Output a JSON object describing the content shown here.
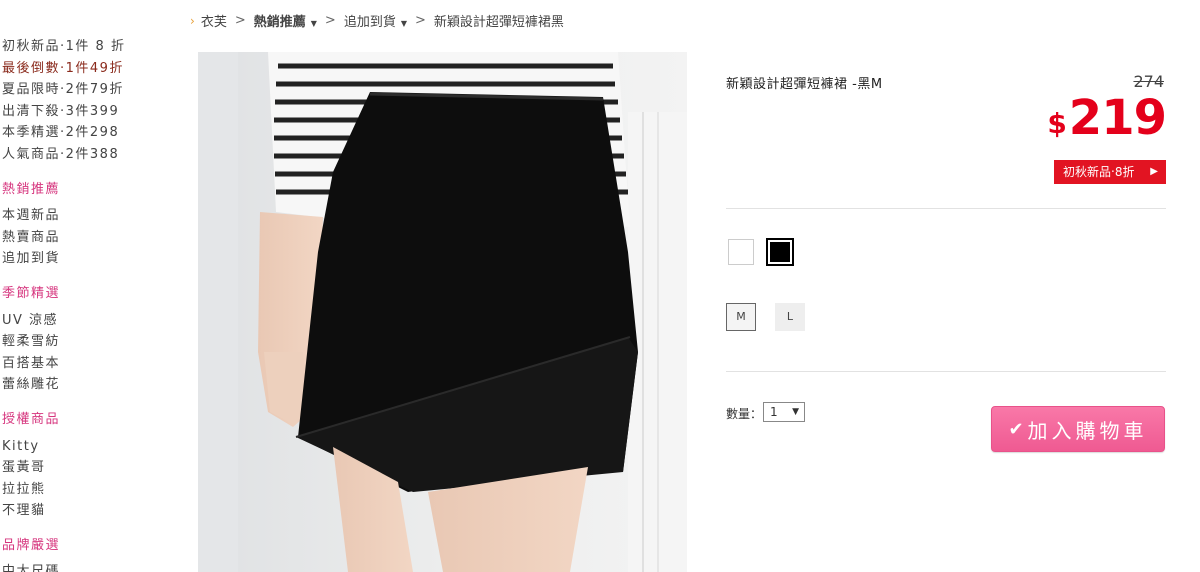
{
  "breadcrumb": {
    "items": [
      "衣芙",
      "熱銷推薦",
      "追加到貨",
      "新穎設計超彈短褲裙黑"
    ]
  },
  "sidebar": {
    "promo_items": [
      "初秋新品‧1件 8 折",
      "最後倒數‧1件49折",
      "夏品限時‧2件79折",
      "出清下殺‧3件399",
      "本季精選‧2件298",
      "人氣商品‧2件388"
    ],
    "sections": [
      {
        "title": "熱銷推薦",
        "items": [
          "本週新品",
          "熱賣商品",
          "追加到貨"
        ]
      },
      {
        "title": "季節精選",
        "items": [
          "UV 涼感",
          "輕柔雪紡",
          "百搭基本",
          "蕾絲雕花"
        ]
      },
      {
        "title": "授權商品",
        "items": [
          "Kitty",
          "蛋黃哥",
          "拉拉熊",
          "不理貓"
        ]
      },
      {
        "title": "品牌嚴選",
        "items": [
          "中大尺碼"
        ]
      }
    ]
  },
  "product": {
    "name": "新穎設計超彈短褲裙 -黑M",
    "old_price": "274",
    "currency": "$",
    "price": "219",
    "promo_tag": "初秋新品‧8折",
    "promo_arrow": "▶",
    "colors": [
      "white",
      "black"
    ],
    "sizes": [
      "M",
      "L"
    ],
    "selected_size": "M",
    "quantity_label": "數量：",
    "quantity_value": "1",
    "quantity_arrow": "▼",
    "add_to_cart": "加入購物車",
    "add_to_cart_icon": "✔"
  },
  "icons": {
    "breadcrumb_home": "›",
    "breadcrumb_sep": ">",
    "dropdown_caret": "▼"
  },
  "colors": {
    "accent_pink": "#ef5a92",
    "price_red": "#e4001b",
    "section_pink": "#d6357e",
    "promo_red": "#e21422"
  }
}
